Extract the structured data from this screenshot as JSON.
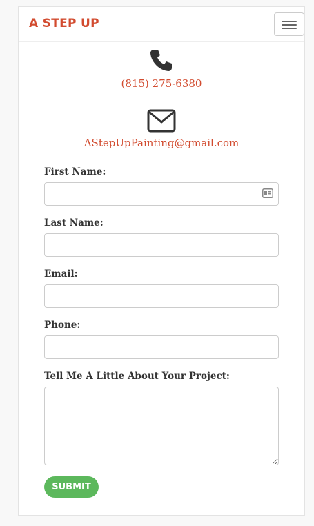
{
  "navbar": {
    "brand": "A STEP UP",
    "toggle_icon": "hamburger-menu-icon"
  },
  "contact": {
    "phone_icon": "phone-icon",
    "phone": "(815) 275-6380",
    "email_icon": "envelope-icon",
    "email": "AStepUpPainting@gmail.com"
  },
  "form": {
    "first_name_label": "First Name:",
    "first_name_value": "",
    "autofill_icon": "contact-card-icon",
    "last_name_label": "Last Name:",
    "last_name_value": "",
    "email_label": "Email:",
    "email_value": "",
    "phone_label": "Phone:",
    "phone_value": "",
    "project_label": "Tell Me A Little About Your Project:",
    "project_value": "",
    "submit_label": "SUBMIT"
  },
  "colors": {
    "brand": "#d24b2f",
    "submit": "#5cb85c",
    "icon": "#333333"
  }
}
